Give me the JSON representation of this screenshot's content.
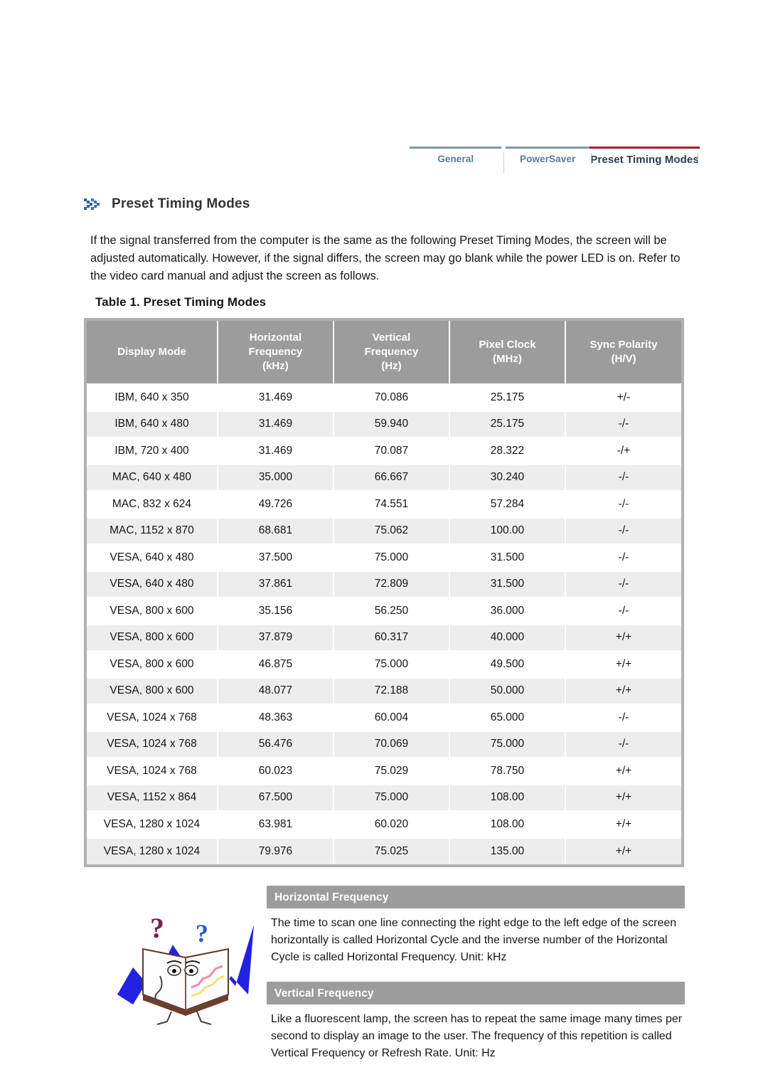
{
  "nav": {
    "tabs": [
      {
        "label": "General",
        "active": false
      },
      {
        "label": "PowerSaver",
        "active": false
      },
      {
        "label": "Preset Timing Modes",
        "active": true
      }
    ],
    "active_accent": "#a81c2b",
    "inactive_rule": "#7f9aa5"
  },
  "header": {
    "icon": "double-chevron-icon",
    "title": "Preset Timing Modes"
  },
  "intro": {
    "text": "If the signal transferred from the computer is the same as the following Preset Timing Modes, the screen will be adjusted automatically. However, if the signal differs, the screen may go blank while the power LED is on. Refer to the video card manual and adjust the screen as follows."
  },
  "table": {
    "caption": "Table 1. Preset Timing Modes",
    "header_bg": "#9c9c9c",
    "alt_row_bg": "#ededed",
    "columns": [
      "Display Mode",
      "Horizontal\nFrequency\n(kHz)",
      "Vertical\nFrequency\n(Hz)",
      "Pixel Clock\n(MHz)",
      "Sync Polarity\n(H/V)"
    ],
    "columns_lines": [
      [
        "Display Mode"
      ],
      [
        "Horizontal",
        "Frequency",
        "(kHz)"
      ],
      [
        "Vertical",
        "Frequency",
        "(Hz)"
      ],
      [
        "Pixel Clock",
        "(MHz)"
      ],
      [
        "Sync Polarity",
        "(H/V)"
      ]
    ],
    "rows": [
      [
        "IBM, 640 x 350",
        "31.469",
        "70.086",
        "25.175",
        "+/-"
      ],
      [
        "IBM, 640 x 480",
        "31.469",
        "59.940",
        "25.175",
        "-/-"
      ],
      [
        "IBM, 720 x 400",
        "31.469",
        "70.087",
        "28.322",
        "-/+"
      ],
      [
        "MAC, 640 x 480",
        "35.000",
        "66.667",
        "30.240",
        "-/-"
      ],
      [
        "MAC, 832 x 624",
        "49.726",
        "74.551",
        "57.284",
        "-/-"
      ],
      [
        "MAC, 1152 x 870",
        "68.681",
        "75.062",
        "100.00",
        "-/-"
      ],
      [
        "VESA, 640 x 480",
        "37.500",
        "75.000",
        "31.500",
        "-/-"
      ],
      [
        "VESA, 640 x 480",
        "37.861",
        "72.809",
        "31.500",
        "-/-"
      ],
      [
        "VESA, 800 x 600",
        "35.156",
        "56.250",
        "36.000",
        "-/-"
      ],
      [
        "VESA, 800 x 600",
        "37.879",
        "60.317",
        "40.000",
        "+/+"
      ],
      [
        "VESA, 800 x 600",
        "46.875",
        "75.000",
        "49.500",
        "+/+"
      ],
      [
        "VESA, 800 x 600",
        "48.077",
        "72.188",
        "50.000",
        "+/+"
      ],
      [
        "VESA, 1024 x 768",
        "48.363",
        "60.004",
        "65.000",
        "-/-"
      ],
      [
        "VESA, 1024 x 768",
        "56.476",
        "70.069",
        "75.000",
        "-/-"
      ],
      [
        "VESA, 1024 x 768",
        "60.023",
        "75.029",
        "78.750",
        "+/+"
      ],
      [
        "VESA, 1152 x 864",
        "67.500",
        "75.000",
        "108.00",
        "+/+"
      ],
      [
        "VESA, 1280 x 1024",
        "63.981",
        "60.020",
        "108.00",
        "+/+"
      ],
      [
        "VESA, 1280 x 1024",
        "79.976",
        "75.025",
        "135.00",
        "+/+"
      ]
    ]
  },
  "illustration": {
    "name": "open-book-question-marks-illustration"
  },
  "info_sections": [
    {
      "title": "Horizontal Frequency",
      "body": "The time to scan one line connecting the right edge to the left edge of the screen horizontally is called Horizontal Cycle and the inverse number of the Horizontal Cycle is called Horizontal Frequency. Unit: kHz"
    },
    {
      "title": "Vertical Frequency",
      "body": "Like a fluorescent lamp, the screen has to repeat the same image many times per second to display an image to the user. The frequency of this repetition is called Vertical Frequency or Refresh Rate. Unit: Hz"
    }
  ]
}
